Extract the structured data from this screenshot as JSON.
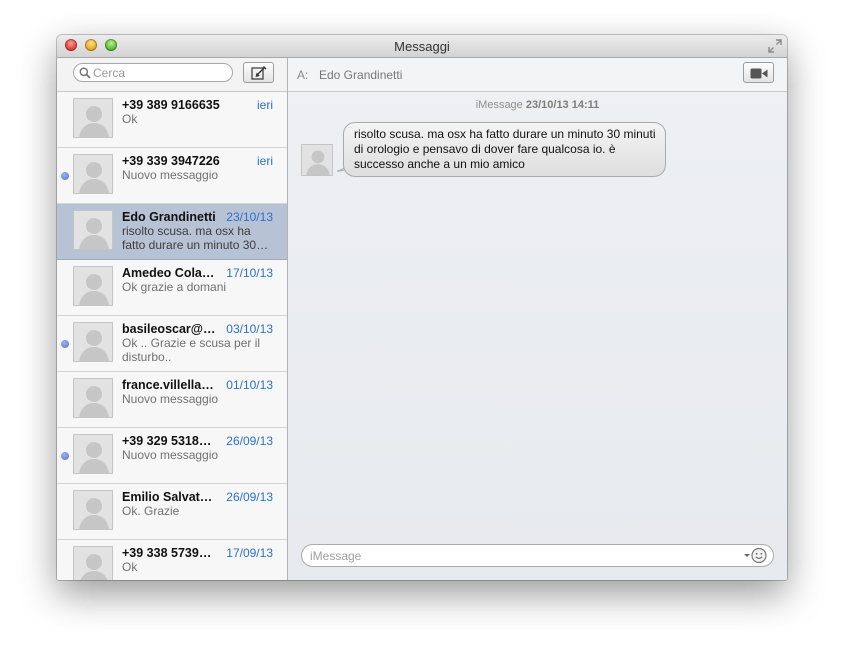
{
  "window": {
    "title": "Messaggi"
  },
  "sidebar": {
    "search_placeholder": "Cerca",
    "conversations": [
      {
        "name": "+39 389 9166635",
        "date": "ieri",
        "preview": "Ok",
        "unread": false,
        "selected": false
      },
      {
        "name": "+39 339 3947226",
        "date": "ieri",
        "preview": "Nuovo messaggio",
        "unread": true,
        "selected": false
      },
      {
        "name": "Edo Grandinetti",
        "date": "23/10/13",
        "preview": "risolto scusa. ma osx ha fatto durare un minuto 30…",
        "unread": false,
        "selected": true
      },
      {
        "name": "Amedeo Cola…",
        "date": "17/10/13",
        "preview": "Ok grazie a domani",
        "unread": false,
        "selected": false
      },
      {
        "name": "basileoscar@…",
        "date": "03/10/13",
        "preview": "Ok .. Grazie e scusa per il disturbo..",
        "unread": true,
        "selected": false
      },
      {
        "name": "france.villella…",
        "date": "01/10/13",
        "preview": "Nuovo messaggio",
        "unread": false,
        "selected": false
      },
      {
        "name": "+39 329 5318…",
        "date": "26/09/13",
        "preview": "Nuovo messaggio",
        "unread": true,
        "selected": false
      },
      {
        "name": "Emilio Salvat…",
        "date": "26/09/13",
        "preview": "Ok. Grazie",
        "unread": false,
        "selected": false
      },
      {
        "name": "+39 338 5739…",
        "date": "17/09/13",
        "preview": "Ok",
        "unread": false,
        "selected": false
      }
    ]
  },
  "chat": {
    "to_label": "A:",
    "recipient": "Edo Grandinetti",
    "service": "iMessage",
    "timestamp": "23/10/13 14:11",
    "message": "risolto scusa. ma osx ha fatto durare un minuto 30 minuti di orologio e pensavo di dover fare qualcosa io. è successo anche a un mio amico",
    "input_placeholder": "iMessage"
  },
  "colors": {
    "accent_date": "#2b6fd1",
    "selected_row": "#b7c2d5",
    "unread_dot": "#5470d0"
  },
  "icons": {
    "search": "magnifier-icon",
    "compose": "compose-icon",
    "video": "video-camera-icon",
    "emoji": "smiley-icon",
    "fullscreen": "fullscreen-icon"
  }
}
